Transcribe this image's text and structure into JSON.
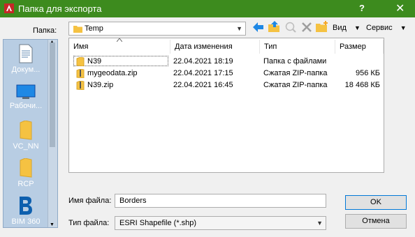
{
  "window": {
    "title": "Папка для экспорта",
    "help": "?",
    "close": "✕"
  },
  "folder": {
    "label": "Папка:",
    "value": "Temp"
  },
  "toolbar": {
    "view_label": "Вид",
    "tools_label": "Сервис"
  },
  "places": [
    {
      "label": "Докум..."
    },
    {
      "label": "Рабочи..."
    },
    {
      "label": "VC_NN"
    },
    {
      "label": "RCP"
    },
    {
      "label": "BIM 360"
    }
  ],
  "columns": {
    "name": "Имя",
    "date": "Дата изменения",
    "type": "Тип",
    "size": "Размер"
  },
  "files": [
    {
      "name": "N39",
      "date": "22.04.2021 18:19",
      "type": "Папка с файлами",
      "size": ""
    },
    {
      "name": "mygeodata.zip",
      "date": "22.04.2021 17:15",
      "type": "Сжатая ZIP-папка",
      "size": "956 КБ"
    },
    {
      "name": "N39.zip",
      "date": "22.04.2021 16:45",
      "type": "Сжатая ZIP-папка",
      "size": "18 468 КБ"
    }
  ],
  "filename": {
    "label": "Имя файла:",
    "value": "Borders"
  },
  "filetype": {
    "label": "Тип файла:",
    "value": "ESRI Shapefile  (*.shp)"
  },
  "buttons": {
    "ok": "OK",
    "cancel": "Отмена"
  },
  "colors": {
    "titlebar": "#3d8b1e",
    "places_bg": "#b8cde3",
    "folder": "#f5c242",
    "accent": "#1e88e5"
  }
}
